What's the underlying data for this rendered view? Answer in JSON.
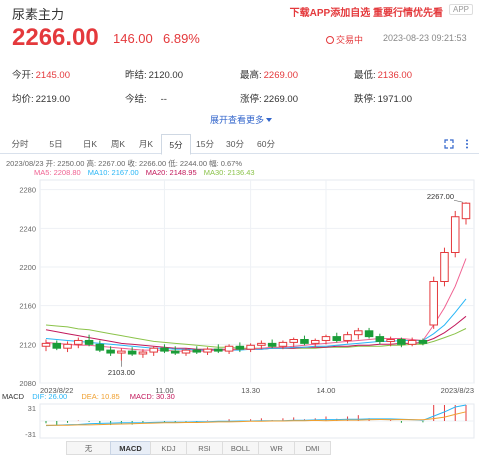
{
  "header": {
    "title": "尿素主力",
    "promo": "下载APP添加自选 重要行情优先看",
    "app_badge": "APP",
    "price": "2266.00",
    "change": "146.00",
    "change_pct": "6.89%",
    "status": "交易中",
    "time": "2023-08-23 09:21:53"
  },
  "stats": {
    "open_label": "今开:",
    "open": "2145.00",
    "prev_close_label": "昨结:",
    "prev_close": "2120.00",
    "high_label": "最高:",
    "high": "2269.00",
    "low_label": "最低:",
    "low": "2136.00",
    "avg_label": "均价:",
    "avg": "2219.00",
    "settle_label": "今结:",
    "settle": "--",
    "limit_up_label": "涨停:",
    "limit_up": "2269.00",
    "limit_down_label": "跌停:",
    "limit_down": "1971.00"
  },
  "expand_label": "展开查看更多",
  "tabs": [
    "分时",
    "5日",
    "日K",
    "周K",
    "月K",
    "5分",
    "15分",
    "30分",
    "60分"
  ],
  "active_tab": "5分",
  "tools": [
    "fullscreen-icon",
    "more-icon"
  ],
  "ohlc_line": "2023/08/23  开: 2250.00  高: 2267.00  收: 2266.00  低: 2244.00  幅: 0.67%",
  "ma": {
    "ma5": "MA5: 2208.80",
    "ma10": "MA10: 2167.00",
    "ma20": "MA20: 2148.95",
    "ma30": "MA30: 2136.43"
  },
  "colors": {
    "up": "#e4393c",
    "down": "#1a9c38",
    "ma5": "#f06292",
    "ma10": "#29b6f6",
    "ma20": "#c2185b",
    "ma30": "#8bc34a",
    "accent": "#3366cc"
  },
  "chart_data": {
    "type": "candlestick",
    "y_ticks": [
      "2280",
      "2240",
      "2200",
      "2160",
      "2120",
      "2080"
    ],
    "ylim": [
      2080,
      2290
    ],
    "x_ticks": [
      "2023/8/22",
      "11.00",
      "13.30",
      "14.00",
      "2023/8/23"
    ],
    "annotations": {
      "high_label": "2267.00",
      "low_label": "2103.00"
    },
    "candles": [
      {
        "o": 2118,
        "h": 2125,
        "l": 2113,
        "c": 2121
      },
      {
        "o": 2121,
        "h": 2124,
        "l": 2114,
        "c": 2116
      },
      {
        "o": 2116,
        "h": 2123,
        "l": 2112,
        "c": 2120
      },
      {
        "o": 2120,
        "h": 2127,
        "l": 2116,
        "c": 2124
      },
      {
        "o": 2124,
        "h": 2130,
        "l": 2118,
        "c": 2120
      },
      {
        "o": 2120,
        "h": 2124,
        "l": 2112,
        "c": 2114
      },
      {
        "o": 2114,
        "h": 2118,
        "l": 2108,
        "c": 2111
      },
      {
        "o": 2111,
        "h": 2116,
        "l": 2103,
        "c": 2113
      },
      {
        "o": 2113,
        "h": 2117,
        "l": 2108,
        "c": 2110
      },
      {
        "o": 2110,
        "h": 2115,
        "l": 2106,
        "c": 2112
      },
      {
        "o": 2112,
        "h": 2118,
        "l": 2108,
        "c": 2116
      },
      {
        "o": 2116,
        "h": 2120,
        "l": 2111,
        "c": 2113
      },
      {
        "o": 2113,
        "h": 2118,
        "l": 2109,
        "c": 2111
      },
      {
        "o": 2111,
        "h": 2116,
        "l": 2108,
        "c": 2114
      },
      {
        "o": 2114,
        "h": 2118,
        "l": 2110,
        "c": 2112
      },
      {
        "o": 2112,
        "h": 2117,
        "l": 2109,
        "c": 2115
      },
      {
        "o": 2115,
        "h": 2120,
        "l": 2111,
        "c": 2113
      },
      {
        "o": 2113,
        "h": 2120,
        "l": 2110,
        "c": 2118
      },
      {
        "o": 2118,
        "h": 2122,
        "l": 2112,
        "c": 2115
      },
      {
        "o": 2115,
        "h": 2121,
        "l": 2112,
        "c": 2119
      },
      {
        "o": 2119,
        "h": 2124,
        "l": 2115,
        "c": 2121
      },
      {
        "o": 2121,
        "h": 2125,
        "l": 2116,
        "c": 2118
      },
      {
        "o": 2118,
        "h": 2124,
        "l": 2115,
        "c": 2122
      },
      {
        "o": 2122,
        "h": 2127,
        "l": 2117,
        "c": 2125
      },
      {
        "o": 2125,
        "h": 2129,
        "l": 2119,
        "c": 2121
      },
      {
        "o": 2121,
        "h": 2126,
        "l": 2117,
        "c": 2124
      },
      {
        "o": 2124,
        "h": 2130,
        "l": 2120,
        "c": 2128
      },
      {
        "o": 2128,
        "h": 2132,
        "l": 2122,
        "c": 2124
      },
      {
        "o": 2124,
        "h": 2133,
        "l": 2121,
        "c": 2130
      },
      {
        "o": 2130,
        "h": 2137,
        "l": 2125,
        "c": 2134
      },
      {
        "o": 2134,
        "h": 2137,
        "l": 2126,
        "c": 2128
      },
      {
        "o": 2128,
        "h": 2131,
        "l": 2120,
        "c": 2123
      },
      {
        "o": 2123,
        "h": 2128,
        "l": 2118,
        "c": 2125
      },
      {
        "o": 2125,
        "h": 2127,
        "l": 2117,
        "c": 2120
      },
      {
        "o": 2120,
        "h": 2127,
        "l": 2118,
        "c": 2124
      },
      {
        "o": 2124,
        "h": 2126,
        "l": 2119,
        "c": 2121
      },
      {
        "o": 2140,
        "h": 2190,
        "l": 2136,
        "c": 2185
      },
      {
        "o": 2185,
        "h": 2220,
        "l": 2180,
        "c": 2215
      },
      {
        "o": 2215,
        "h": 2258,
        "l": 2210,
        "c": 2252
      },
      {
        "o": 2250,
        "h": 2267,
        "l": 2244,
        "c": 2266
      }
    ],
    "ma5": [
      2122,
      2121,
      2120,
      2119,
      2119,
      2118,
      2117,
      2116,
      2115,
      2114,
      2114,
      2114,
      2113,
      2113,
      2113,
      2113,
      2114,
      2114,
      2115,
      2115,
      2116,
      2117,
      2117,
      2118,
      2119,
      2120,
      2121,
      2122,
      2123,
      2124,
      2125,
      2126,
      2126,
      2126,
      2125,
      2124,
      2140,
      2158,
      2180,
      2208.8
    ],
    "ma10": [
      2126,
      2125,
      2124,
      2123,
      2122,
      2121,
      2120,
      2119,
      2118,
      2117,
      2116,
      2116,
      2115,
      2115,
      2114,
      2114,
      2114,
      2114,
      2114,
      2115,
      2115,
      2116,
      2116,
      2117,
      2117,
      2118,
      2118,
      2119,
      2120,
      2121,
      2122,
      2123,
      2123,
      2124,
      2124,
      2124,
      2131,
      2140,
      2153,
      2167
    ],
    "ma20": [
      2135,
      2133,
      2131,
      2129,
      2127,
      2125,
      2123,
      2121,
      2120,
      2119,
      2118,
      2117,
      2116,
      2116,
      2115,
      2115,
      2115,
      2115,
      2115,
      2115,
      2115,
      2116,
      2116,
      2116,
      2117,
      2117,
      2117,
      2118,
      2118,
      2119,
      2119,
      2120,
      2120,
      2121,
      2121,
      2122,
      2126,
      2132,
      2140,
      2148.95
    ],
    "ma30": [
      2140,
      2139,
      2138,
      2136,
      2135,
      2133,
      2131,
      2129,
      2127,
      2125,
      2123,
      2122,
      2121,
      2120,
      2119,
      2118,
      2117,
      2117,
      2116,
      2116,
      2116,
      2116,
      2116,
      2116,
      2116,
      2116,
      2117,
      2117,
      2117,
      2118,
      2118,
      2118,
      2119,
      2119,
      2120,
      2120,
      2123,
      2127,
      2131,
      2136.43
    ],
    "macd": {
      "label": "MACD",
      "dif": "DIF: 26.00",
      "dea": "DEA: 10.85",
      "macd": "MACD: 30.30",
      "y_ticks": [
        "31",
        "-31"
      ]
    }
  },
  "indicator_tabs": [
    "无",
    "MACD",
    "KDJ",
    "RSI",
    "BOLL",
    "WR",
    "DMI"
  ],
  "active_indicator": "MACD"
}
